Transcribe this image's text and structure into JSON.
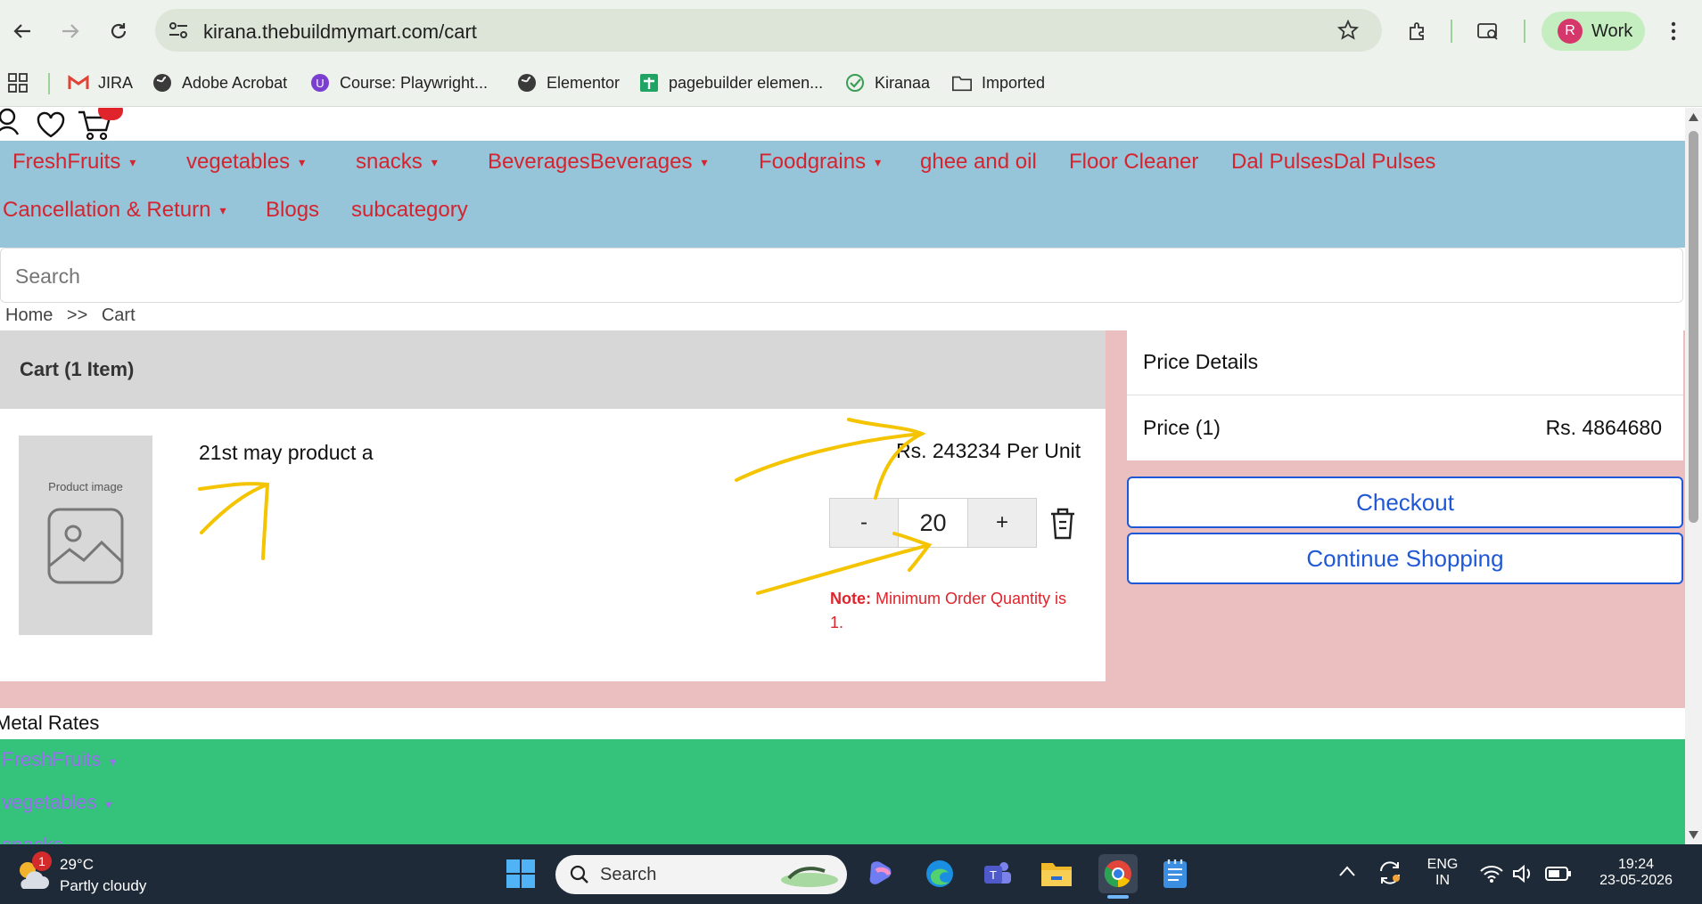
{
  "browser": {
    "url": "kirana.thebuildmymart.com/cart",
    "profile_initial": "R",
    "profile_label": "Work",
    "bookmarks": [
      "JIRA",
      "Adobe Acrobat",
      "Course: Playwright...",
      "Elementor",
      "pagebuilder elemen...",
      "Kiranaa",
      "Imported"
    ]
  },
  "nav": {
    "categories_row1": [
      "FreshFruits",
      "vegetables",
      "snacks",
      "BeveragesBeverages",
      "Foodgrains",
      "ghee and oil",
      "Floor Cleaner",
      "Dal PulsesDal Pulses"
    ],
    "categories_row2": [
      "Cancellation & Return",
      "Blogs",
      "subcategory"
    ],
    "caret": "▾"
  },
  "search": {
    "placeholder": "Search"
  },
  "breadcrumb": {
    "home": "Home",
    "separator": ">>",
    "current": "Cart"
  },
  "cart": {
    "title": "Cart (1 Item)",
    "item": {
      "image_label": "Product image",
      "name": "21st may product a",
      "unit_price": "Rs. 243234 Per Unit",
      "quantity": "20",
      "minus_label": "-",
      "plus_label": "+",
      "note_prefix": "Note:",
      "note_text": " Minimum Order Quantity is 1."
    }
  },
  "price_details": {
    "title": "Price Details",
    "price_label": "Price (1)",
    "price_value": "Rs. 4864680",
    "checkout_label": "Checkout",
    "continue_label": "Continue Shopping"
  },
  "footer": {
    "metal_rates": "Metal Rates",
    "items": [
      "FreshFruits",
      "vegetables",
      "snacks"
    ]
  },
  "taskbar": {
    "weather_badge": "1",
    "temperature": "29°C",
    "weather": "Partly cloudy",
    "search_label": "Search",
    "lang_line1": "ENG",
    "lang_line2": "IN",
    "time": "19:24",
    "date": "23-05-2026"
  },
  "colors": {
    "nav_bg": "#96c4d8",
    "nav_text": "#d42430",
    "cart_area_bg": "#ebbfbf",
    "button_blue": "#1f58d6",
    "footer_green": "#35c27a",
    "annotation_yellow": "#f5c400"
  }
}
